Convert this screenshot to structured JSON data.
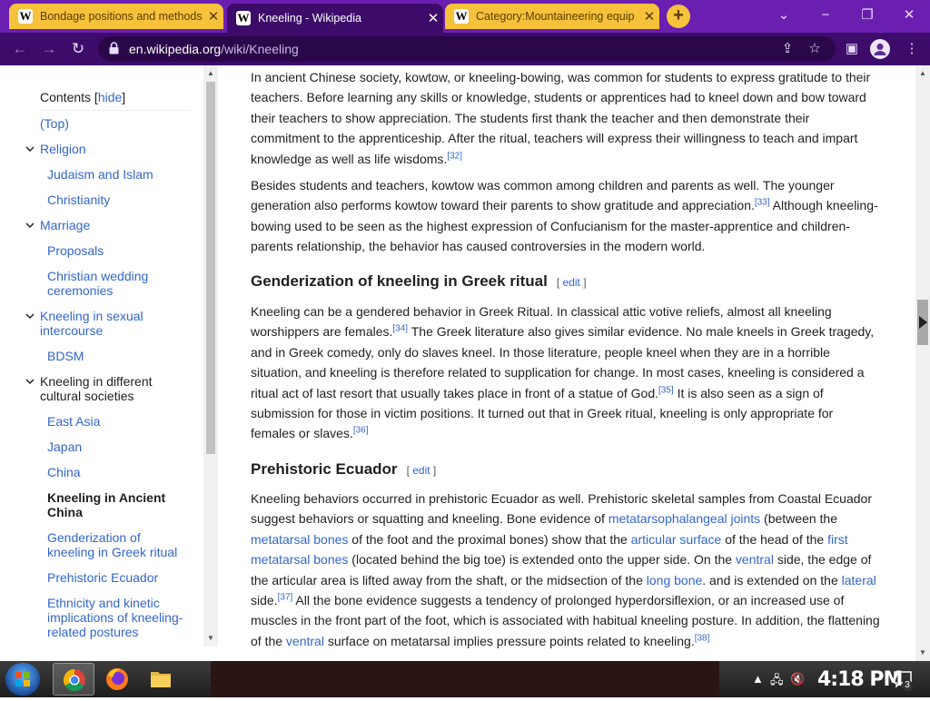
{
  "browser": {
    "tabs": [
      {
        "title": "Bondage positions and methods",
        "close": "✕"
      },
      {
        "title": "Kneeling - Wikipedia",
        "close": "✕"
      },
      {
        "title": "Category:Mountaineering equip",
        "close": "✕"
      }
    ],
    "new_tab": "+",
    "url_domain": "en.wikipedia.org",
    "url_path": "/wiki/Kneeling",
    "colors": {
      "frame": "#6b1fb0",
      "active_tab": "#3d0c6a",
      "inactive_tab": "#f6c23b"
    }
  },
  "toc": {
    "title": "Contents",
    "hide_open": " [",
    "hide_label": "hide",
    "hide_close": "]",
    "items": [
      {
        "label": "(Top)"
      },
      {
        "label": "Religion"
      },
      {
        "label": "Judaism and Islam"
      },
      {
        "label": "Christianity"
      },
      {
        "label": "Marriage"
      },
      {
        "label": "Proposals"
      },
      {
        "label": "Christian wedding ceremonies"
      },
      {
        "label": "Kneeling in sexual intercourse"
      },
      {
        "label": "BDSM"
      },
      {
        "label": "Kneeling in different cultural societies"
      },
      {
        "label": "East Asia"
      },
      {
        "label": "Japan"
      },
      {
        "label": "China"
      },
      {
        "label": "Kneeling in Ancient China"
      },
      {
        "label": "Genderization of kneeling in Greek ritual"
      },
      {
        "label": "Prehistoric Ecuador"
      },
      {
        "label": "Ethnicity and kinetic implications of kneeling-related postures"
      }
    ]
  },
  "article": {
    "p1": {
      "text": "In ancient Chinese society, kowtow, or kneeling-bowing, was common for students to express gratitude to their teachers. Before learning any skills or knowledge, students or apprentices had to kneel down and bow toward their teachers to show appreciation. The students first thank the teacher and then demonstrate their commitment to the apprenticeship. After the ritual, teachers will express their willingness to teach and impart knowledge as well as life wisdoms.",
      "ref": "[32]"
    },
    "p2": {
      "text_a": "Besides students and teachers, kowtow was common among children and parents as well. The younger generation also performs kowtow toward their parents to show gratitude and appreciation.",
      "ref": "[33]",
      "text_b": " Although kneeling-bowing used to be seen as the highest expression of Confucianism for the master-apprentice and children-parents relationship, the behavior has caused controversies in the modern world."
    },
    "h_greek": {
      "title": "Genderization of kneeling in Greek ritual",
      "edit_open": "[ ",
      "edit": "edit",
      "edit_close": " ]"
    },
    "p3": {
      "a": "Kneeling can be a gendered behavior in Greek Ritual. In classical attic votive reliefs, almost all kneeling worshippers are females.",
      "ref1": "[34]",
      "b": " The Greek literature also gives similar evidence. No male kneels in Greek tragedy, and in Greek comedy, only do slaves kneel. In those literature, people kneel when they are in a horrible situation, and kneeling is therefore related to supplication for change. In most cases, kneeling is considered a ritual act of last resort that usually takes place in front of a statue of God.",
      "ref2": "[35]",
      "c": " It is also seen as a sign of submission for those in victim positions. It turned out that in Greek ritual, kneeling is only appropriate for females or slaves.",
      "ref3": "[36]"
    },
    "h_ecuador": {
      "title": "Prehistoric Ecuador",
      "edit_open": "[ ",
      "edit": "edit",
      "edit_close": " ]"
    },
    "p4": {
      "t1": "Kneeling behaviors occurred in prehistoric Ecuador as well. Prehistoric skeletal samples from Coastal Ecuador suggest behaviors or squatting and kneeling. Bone evidence of ",
      "l1": "metatarsophalangeal joints",
      "t2": " (between the ",
      "l2": "metatarsal bones",
      "t3": " of the foot and the proximal bones) show that the ",
      "l3": "articular surface",
      "t4": " of the head of the ",
      "l4": "first metatarsal bones",
      "t5": " (located behind the big toe) is extended onto the upper side. On the ",
      "l5": "ventral",
      "t6": " side, the edge of the articular area is lifted away from the shaft, or the midsection of the ",
      "l6": "long bone",
      "t7": ". and is extended on the ",
      "l7": "lateral",
      "t8": " side.",
      "ref1": "[37]",
      "t9": " All the bone evidence suggests a tendency of prolonged hyperdorsiflexion, or an increased use of muscles in the front part of the foot, which is associated with habitual kneeling posture. In addition, the flattening of the ",
      "l8": "ventral",
      "t10": " surface on metatarsal implies pressure points related to kneeling.",
      "ref2": "[38]"
    }
  },
  "taskbar": {
    "clock": "4:18 PM",
    "notification_count": "3",
    "apps": [
      "start",
      "chrome",
      "firefox",
      "file-explorer"
    ]
  }
}
